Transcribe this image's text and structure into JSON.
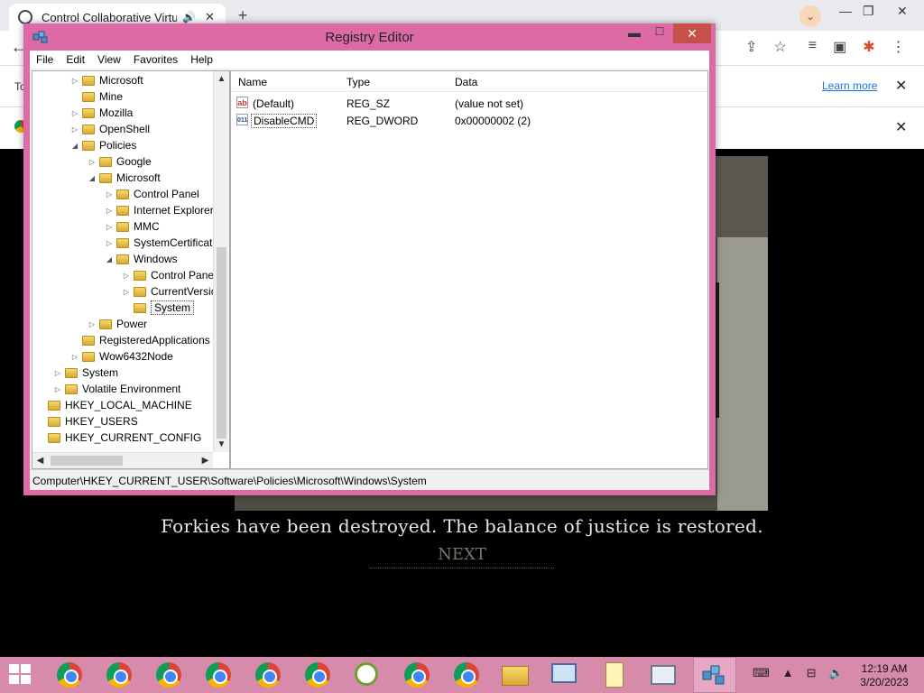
{
  "browser": {
    "tab_title": "Control Collaborative Virtual",
    "audio_icon": "speaker-icon",
    "close_glyph": "✕",
    "new_tab_glyph": "+",
    "infobar_prefix": "To",
    "learn_more": "Learn more"
  },
  "game": {
    "message": "Forkies have been destroyed. The balance of justice is restored.",
    "next": "NEXT"
  },
  "regedit": {
    "title": "Registry Editor",
    "menu": [
      "File",
      "Edit",
      "View",
      "Favorites",
      "Help"
    ],
    "tree": [
      {
        "label": "Microsoft",
        "depth": 1,
        "expander": "▷"
      },
      {
        "label": "Mine",
        "depth": 1,
        "expander": ""
      },
      {
        "label": "Mozilla",
        "depth": 1,
        "expander": "▷"
      },
      {
        "label": "OpenShell",
        "depth": 1,
        "expander": "▷"
      },
      {
        "label": "Policies",
        "depth": 1,
        "expander": "◢"
      },
      {
        "label": "Google",
        "depth": 2,
        "expander": "▷"
      },
      {
        "label": "Microsoft",
        "depth": 2,
        "expander": "◢"
      },
      {
        "label": "Control Panel",
        "depth": 3,
        "expander": "▷"
      },
      {
        "label": "Internet Explorer",
        "depth": 3,
        "expander": "▷"
      },
      {
        "label": "MMC",
        "depth": 3,
        "expander": "▷"
      },
      {
        "label": "SystemCertificates",
        "depth": 3,
        "expander": "▷"
      },
      {
        "label": "Windows",
        "depth": 3,
        "expander": "◢"
      },
      {
        "label": "Control Panel",
        "depth": 4,
        "expander": "▷"
      },
      {
        "label": "CurrentVersion",
        "depth": 4,
        "expander": "▷"
      },
      {
        "label": "System",
        "depth": 4,
        "expander": "",
        "selected": true
      },
      {
        "label": "Power",
        "depth": 2,
        "expander": "▷"
      },
      {
        "label": "RegisteredApplications",
        "depth": 1,
        "expander": ""
      },
      {
        "label": "Wow6432Node",
        "depth": 1,
        "expander": "▷"
      },
      {
        "label": "System",
        "depth": 0,
        "expander": "▷"
      },
      {
        "label": "Volatile Environment",
        "depth": 0,
        "expander": "▷"
      },
      {
        "label": "HKEY_LOCAL_MACHINE",
        "depth": -1,
        "expander": ""
      },
      {
        "label": "HKEY_USERS",
        "depth": -1,
        "expander": ""
      },
      {
        "label": "HKEY_CURRENT_CONFIG",
        "depth": -1,
        "expander": ""
      }
    ],
    "columns": {
      "name": "Name",
      "type": "Type",
      "data": "Data"
    },
    "values": [
      {
        "icon": "ab",
        "name": "(Default)",
        "type": "REG_SZ",
        "data": "(value not set)"
      },
      {
        "icon": "011",
        "name": "DisableCMD",
        "type": "REG_DWORD",
        "data": "0x00000002 (2)"
      }
    ],
    "status_path": "Computer\\HKEY_CURRENT_USER\\Software\\Policies\\Microsoft\\Windows\\System"
  },
  "taskbar": {
    "time": "12:19 AM",
    "date": "3/20/2023"
  }
}
